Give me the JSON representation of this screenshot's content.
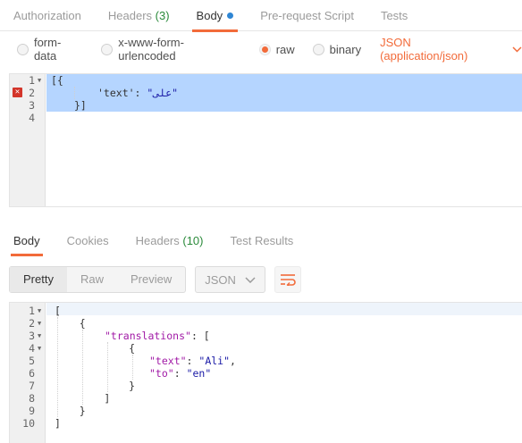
{
  "request_tabs": [
    {
      "label": "Authorization",
      "count": ""
    },
    {
      "label": "Headers",
      "count": "(3)"
    },
    {
      "label": "Body",
      "count": ""
    },
    {
      "label": "Pre-request Script",
      "count": ""
    },
    {
      "label": "Tests",
      "count": ""
    }
  ],
  "body_types": [
    "form-data",
    "x-www-form-urlencoded",
    "raw",
    "binary"
  ],
  "selected_body_type": "raw",
  "content_type": "JSON (application/json)",
  "request_editor": {
    "lines": [
      {
        "num": "1",
        "text": "[{"
      },
      {
        "num": "2",
        "key": "'text'",
        "sep": ": ",
        "value": "\"علی\""
      },
      {
        "num": "3",
        "text": "}]"
      },
      {
        "num": "4",
        "text": ""
      }
    ]
  },
  "response_tabs": [
    {
      "label": "Body",
      "count": ""
    },
    {
      "label": "Cookies",
      "count": ""
    },
    {
      "label": "Headers",
      "count": "(10)"
    },
    {
      "label": "Test Results",
      "count": ""
    }
  ],
  "view_modes": [
    "Pretty",
    "Raw",
    "Preview"
  ],
  "format": "JSON",
  "response_editor": {
    "lines": [
      {
        "num": "1",
        "text": "["
      },
      {
        "num": "2",
        "text": "    {"
      },
      {
        "num": "3",
        "key": "\"translations\"",
        "rest": ": ["
      },
      {
        "num": "4",
        "text": "            {"
      },
      {
        "num": "5",
        "key": "\"text\"",
        "value": "\"Ali\"",
        "rest": ","
      },
      {
        "num": "6",
        "key": "\"to\"",
        "value": "\"en\""
      },
      {
        "num": "7",
        "text": "            }"
      },
      {
        "num": "8",
        "text": "        ]"
      },
      {
        "num": "9",
        "text": "    }"
      },
      {
        "num": "10",
        "text": "]"
      }
    ]
  },
  "colors": {
    "accent": "#f26b3a",
    "count": "#2a8a3a",
    "selection": "#b5d5ff",
    "error": "#d3352a"
  }
}
